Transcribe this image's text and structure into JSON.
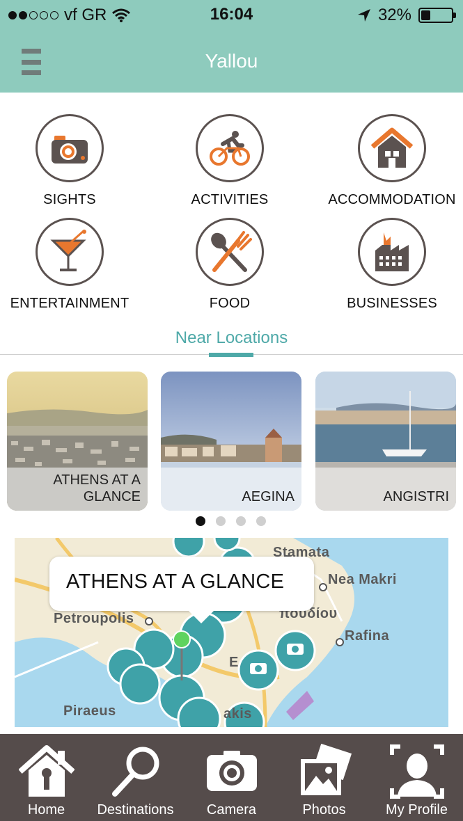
{
  "status_bar": {
    "carrier": "vf GR",
    "time": "16:04",
    "battery": "32%",
    "battery_level": 0.32,
    "signal_bars_filled": 2,
    "signal_bars_total": 5
  },
  "header": {
    "title": "Yallou",
    "menu_icon": "hamburger-menu-icon",
    "color": "#8ecbbd"
  },
  "categories": [
    {
      "label": "SIGHTS",
      "icon": "camera-icon"
    },
    {
      "label": "ACTIVITIES",
      "icon": "cyclist-icon"
    },
    {
      "label": "ACCOMMODATION",
      "icon": "house-icon"
    },
    {
      "label": "ENTERTAINMENT",
      "icon": "cocktail-icon"
    },
    {
      "label": "FOOD",
      "icon": "fork-spoon-icon"
    },
    {
      "label": "BUSINESSES",
      "icon": "factory-icon"
    }
  ],
  "accent_colors": {
    "orange": "#e8772e",
    "dark": "#5b5250",
    "teal": "#4ea9a8"
  },
  "near_locations": {
    "title": "Near Locations",
    "cards": [
      {
        "caption_line1": "ATHENS AT A",
        "caption_line2": "GLANCE"
      },
      {
        "caption_line1": "AEGINA",
        "caption_line2": ""
      },
      {
        "caption_line1": "ANGISTRI",
        "caption_line2": ""
      }
    ],
    "page_count": 4,
    "active_page": 1
  },
  "map": {
    "tooltip": "ATHENS AT A GLANCE",
    "places": [
      "Stamata",
      "Nea Makri",
      "Petroupolis",
      "πουδίου",
      "Rafina",
      "Piraeus",
      "Ε",
      "akis"
    ]
  },
  "tabbar": {
    "tabs": [
      {
        "label": "Home",
        "icon": "home-icon"
      },
      {
        "label": "Destinations",
        "icon": "magnifier-icon"
      },
      {
        "label": "Camera",
        "icon": "camera-icon"
      },
      {
        "label": "Photos",
        "icon": "photos-icon"
      },
      {
        "label": "My Profile",
        "icon": "profile-icon"
      }
    ]
  }
}
